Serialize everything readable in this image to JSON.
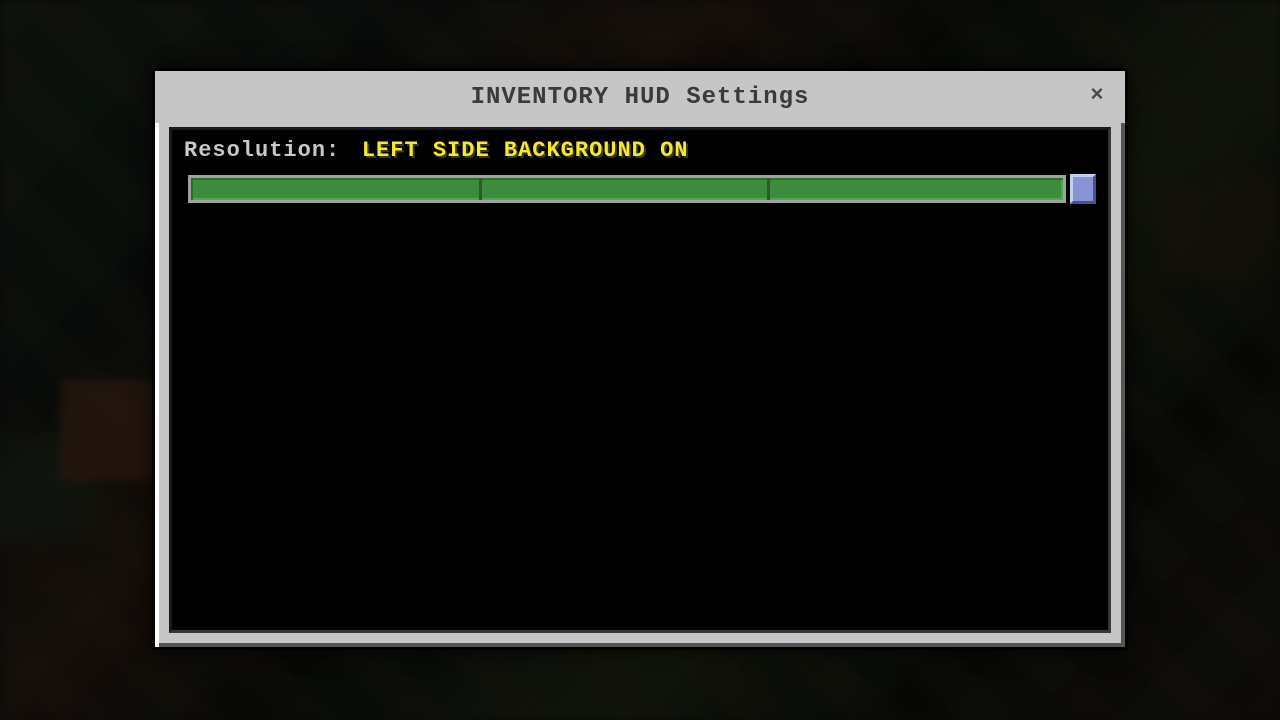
{
  "dialog": {
    "title": "INVENTORY HUD Settings",
    "close_label": "×"
  },
  "setting": {
    "label": "Resolution:",
    "value": "LEFT SIDE BACKGROUND ON"
  },
  "slider": {
    "position_percent": 100,
    "ticks": [
      33,
      66
    ]
  }
}
